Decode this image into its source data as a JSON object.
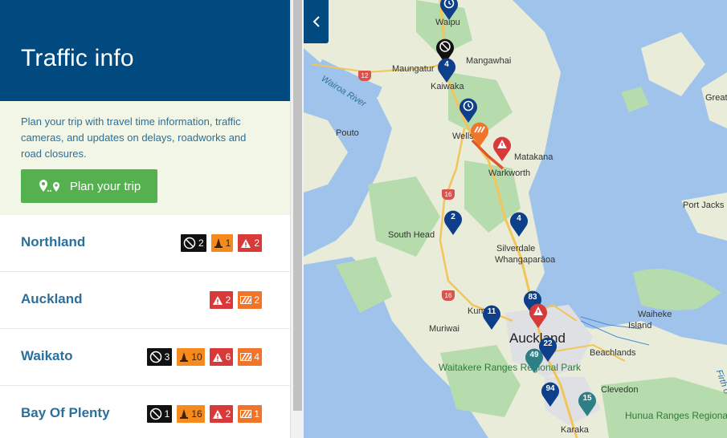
{
  "header": {
    "title": "Traffic info"
  },
  "intro": {
    "text": "Plan your trip with travel time information, traffic cameras, and updates on delays, roadworks and road closures.",
    "plan_button": "Plan your trip"
  },
  "regions": [
    {
      "name": "Northland",
      "badges": [
        {
          "type": "closure",
          "count": "2"
        },
        {
          "type": "works",
          "count": "1"
        },
        {
          "type": "hazard",
          "count": "2"
        }
      ]
    },
    {
      "name": "Auckland",
      "badges": [
        {
          "type": "hazard",
          "count": "2"
        },
        {
          "type": "roadworks",
          "count": "2"
        }
      ]
    },
    {
      "name": "Waikato",
      "badges": [
        {
          "type": "closure",
          "count": "3"
        },
        {
          "type": "works",
          "count": "10"
        },
        {
          "type": "hazard",
          "count": "6"
        },
        {
          "type": "roadworks",
          "count": "4"
        }
      ]
    },
    {
      "name": "Bay Of Plenty",
      "badges": [
        {
          "type": "closure",
          "count": "1"
        },
        {
          "type": "works",
          "count": "16"
        },
        {
          "type": "hazard",
          "count": "2"
        },
        {
          "type": "roadworks",
          "count": "1"
        }
      ]
    }
  ],
  "map": {
    "labels": {
      "waipu": "Waipu",
      "mangawhai": "Mangawhai",
      "maungaturoto": "Maungatur",
      "kaiwaka": "Kaiwaka",
      "wairoa": "Wairoa River",
      "pouto": "Pouto",
      "wellsford": "Wellsf",
      "matakana": "Matakana",
      "warkworth": "Warkworth",
      "south_head": "South Head",
      "silverdale": "Silverdale",
      "whangaparaoa": "Whangaparāoa",
      "port_jackson": "Port Jacks",
      "great": "Great",
      "kumeu": "Kum",
      "muriwai": "Muriwai",
      "auckland": "Auckland",
      "waiheke": "Waiheke",
      "waiheke2": "Island",
      "beachlands": "Beachlands",
      "waitakere": "Waitakere Ranges Regional Park",
      "clevedon": "Clevedon",
      "hunua": "Hunua Ranges Regional Park",
      "karaka": "Karaka",
      "firth": "Firth o"
    },
    "shields": {
      "s12": "12",
      "s16a": "16",
      "s16b": "16"
    },
    "markers": {
      "m4a": "4",
      "m2": "2",
      "m4b": "4",
      "m83": "83",
      "m11": "11",
      "m22": "22",
      "m49": "49",
      "m94": "94",
      "m15": "15"
    },
    "colors": {
      "land": "#e9ecd9",
      "forest": "#b6dcae",
      "water": "#9fc3ea",
      "marker_blue": "#0e3f8a",
      "marker_teal": "#2d7f86"
    }
  }
}
